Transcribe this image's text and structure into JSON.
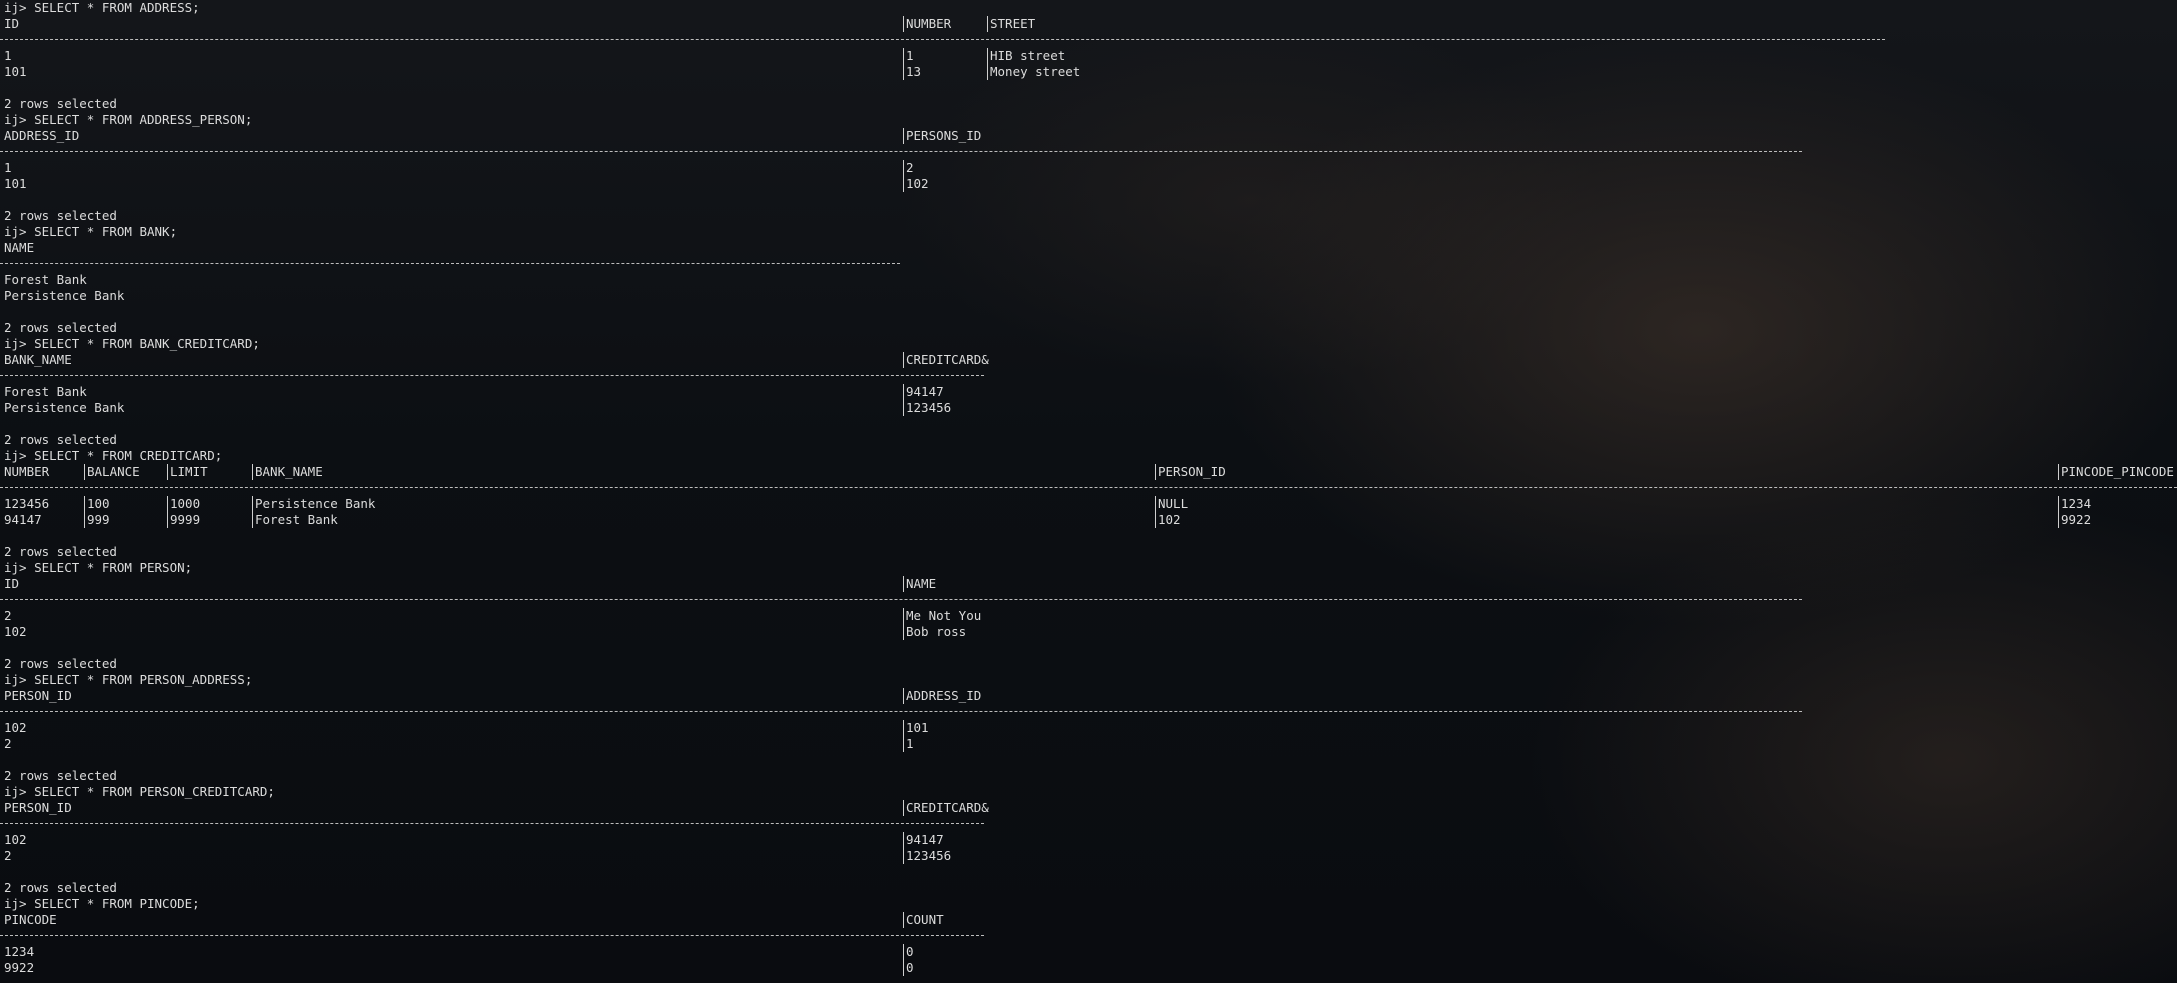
{
  "queries": [
    {
      "prompt": "ij> SELECT * FROM ADDRESS;",
      "columns": [
        "ID",
        "NUMBER",
        "STREET"
      ],
      "rows": [
        [
          "1",
          "1",
          "HIB street"
        ],
        [
          "101",
          "13",
          "Money street"
        ]
      ],
      "footer": "2 rows selected"
    },
    {
      "prompt": "ij> SELECT * FROM ADDRESS_PERSON;",
      "columns": [
        "ADDRESS_ID",
        "PERSONS_ID"
      ],
      "rows": [
        [
          "1",
          "2"
        ],
        [
          "101",
          "102"
        ]
      ],
      "footer": "2 rows selected"
    },
    {
      "prompt": "ij> SELECT * FROM BANK;",
      "columns": [
        "NAME"
      ],
      "rows": [
        [
          "Forest Bank"
        ],
        [
          "Persistence Bank"
        ]
      ],
      "footer": "2 rows selected"
    },
    {
      "prompt": "ij> SELECT * FROM BANK_CREDITCARD;",
      "columns": [
        "BANK_NAME",
        "CREDITCARD&"
      ],
      "rows": [
        [
          "Forest Bank",
          "94147"
        ],
        [
          "Persistence Bank",
          "123456"
        ]
      ],
      "footer": "2 rows selected"
    },
    {
      "prompt": "ij> SELECT * FROM CREDITCARD;",
      "columns": [
        "NUMBER",
        "BALANCE",
        "LIMIT",
        "BANK_NAME",
        "PERSON_ID",
        "PINCODE_PINCODE"
      ],
      "rows": [
        [
          "123456",
          "100",
          "1000",
          "Persistence Bank",
          "NULL",
          "1234"
        ],
        [
          "94147",
          "999",
          "9999",
          "Forest Bank",
          "102",
          "9922"
        ]
      ],
      "footer": "2 rows selected"
    },
    {
      "prompt": "ij> SELECT * FROM PERSON;",
      "columns": [
        "ID",
        "NAME"
      ],
      "rows": [
        [
          "2",
          "Me Not You"
        ],
        [
          "102",
          "Bob ross"
        ]
      ],
      "footer": "2 rows selected"
    },
    {
      "prompt": "ij> SELECT * FROM PERSON_ADDRESS;",
      "columns": [
        "PERSON_ID",
        "ADDRESS_ID"
      ],
      "rows": [
        [
          "102",
          "101"
        ],
        [
          "2",
          "1"
        ]
      ],
      "footer": "2 rows selected"
    },
    {
      "prompt": "ij> SELECT * FROM PERSON_CREDITCARD;",
      "columns": [
        "PERSON_ID",
        "CREDITCARD&"
      ],
      "rows": [
        [
          "102",
          "94147"
        ],
        [
          "2",
          "123456"
        ]
      ],
      "footer": "2 rows selected"
    },
    {
      "prompt": "ij> SELECT * FROM PINCODE;",
      "columns": [
        "PINCODE",
        "COUNT"
      ],
      "rows": [
        [
          "1234",
          "0"
        ],
        [
          "9922",
          "0"
        ]
      ],
      "footer": ""
    }
  ]
}
